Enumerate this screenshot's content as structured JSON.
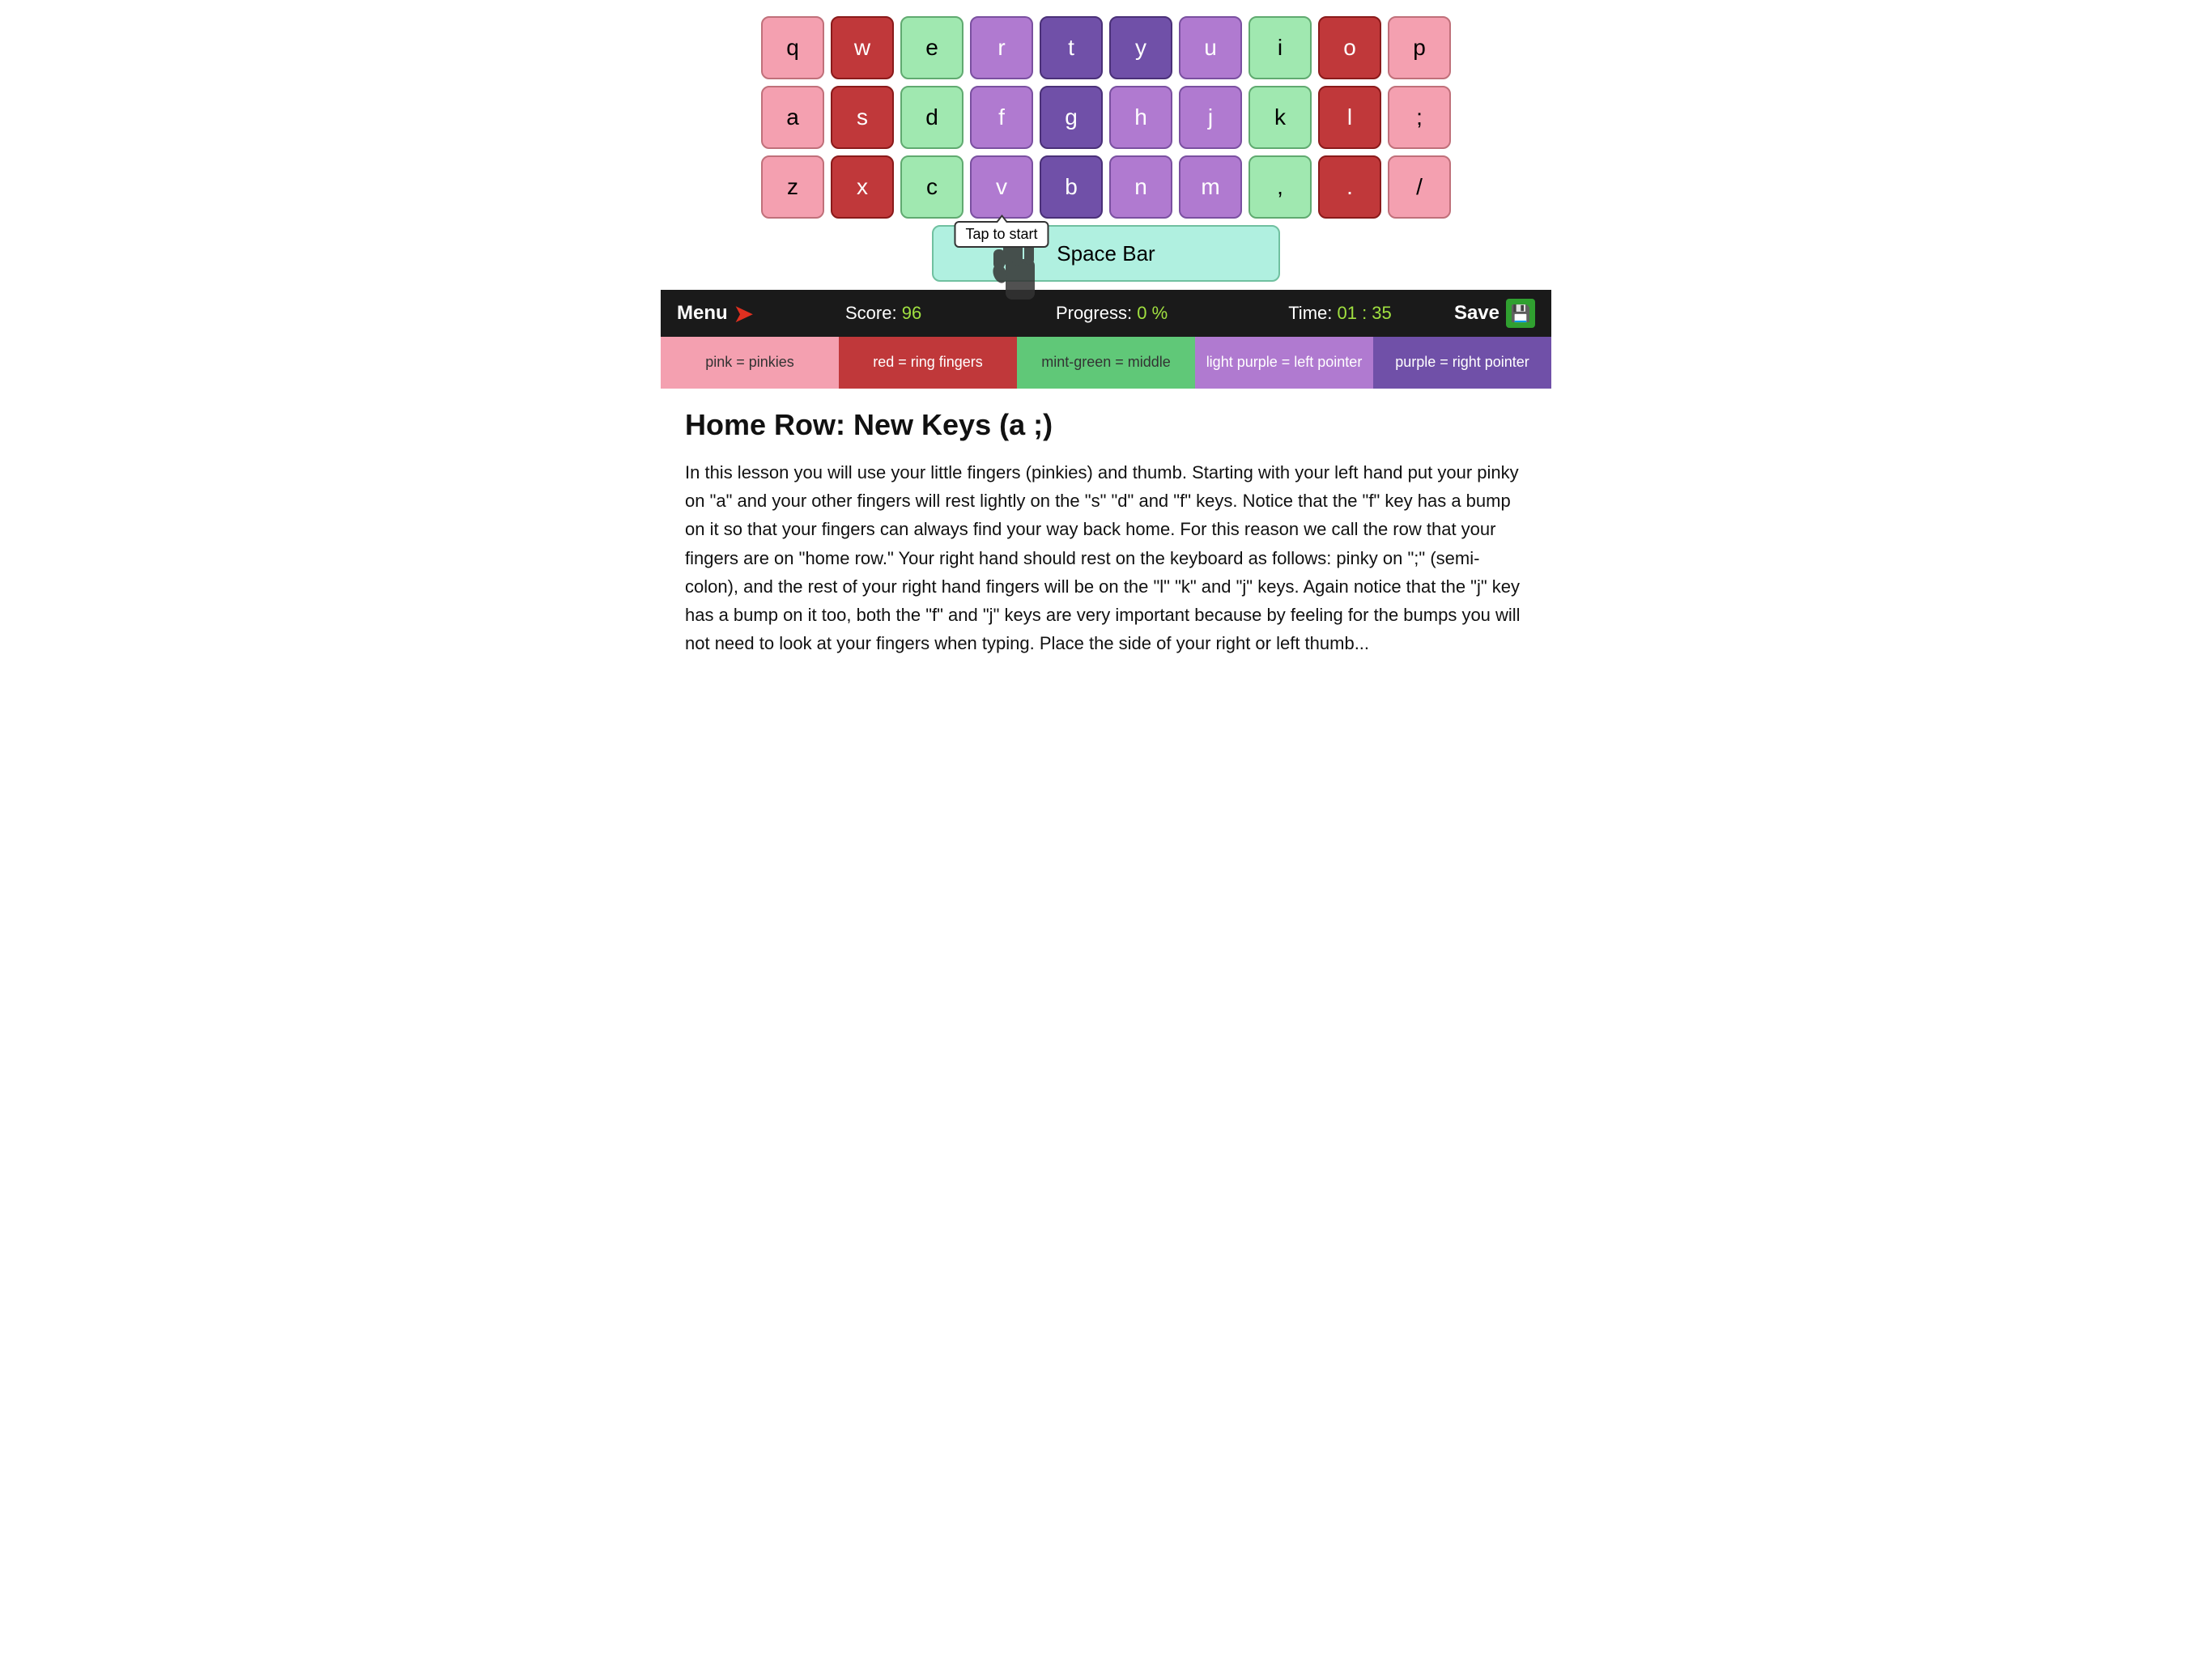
{
  "keyboard": {
    "row1": [
      {
        "key": "q",
        "color": "pink"
      },
      {
        "key": "w",
        "color": "red"
      },
      {
        "key": "e",
        "color": "green"
      },
      {
        "key": "r",
        "color": "purple-light"
      },
      {
        "key": "t",
        "color": "purple-dark"
      },
      {
        "key": "y",
        "color": "purple-dark"
      },
      {
        "key": "u",
        "color": "purple-light"
      },
      {
        "key": "i",
        "color": "green"
      },
      {
        "key": "o",
        "color": "red"
      },
      {
        "key": "p",
        "color": "pink"
      }
    ],
    "row2": [
      {
        "key": "a",
        "color": "pink"
      },
      {
        "key": "s",
        "color": "red"
      },
      {
        "key": "d",
        "color": "green"
      },
      {
        "key": "f",
        "color": "purple-light"
      },
      {
        "key": "g",
        "color": "purple-dark"
      },
      {
        "key": "h",
        "color": "purple-light"
      },
      {
        "key": "j",
        "color": "purple-light"
      },
      {
        "key": "k",
        "color": "green"
      },
      {
        "key": "l",
        "color": "red"
      },
      {
        "key": ";",
        "color": "pink"
      }
    ],
    "row3": [
      {
        "key": "z",
        "color": "pink"
      },
      {
        "key": "x",
        "color": "red"
      },
      {
        "key": "c",
        "color": "green"
      },
      {
        "key": "v",
        "color": "purple-light"
      },
      {
        "key": "b",
        "color": "purple-dark"
      },
      {
        "key": "n",
        "color": "purple-light"
      },
      {
        "key": "m",
        "color": "purple-light"
      },
      {
        "key": ",",
        "color": "green"
      },
      {
        "key": ".",
        "color": "red"
      },
      {
        "key": "/",
        "color": "pink"
      }
    ],
    "spacebar_label": "Space Bar",
    "tap_tooltip": "Tap to start"
  },
  "toolbar": {
    "menu_label": "Menu",
    "score_label": "Score:",
    "score_value": "96",
    "progress_label": "Progress:",
    "progress_value": "0 %",
    "time_label": "Time:",
    "time_value": "01 : 35",
    "save_label": "Save"
  },
  "legend": [
    {
      "label": "pink = pinkies",
      "color": "pink"
    },
    {
      "label": "red = ring fingers",
      "color": "red"
    },
    {
      "label": "mint-green = middle",
      "color": "green"
    },
    {
      "label": "light purple = left pointer",
      "color": "purple-light"
    },
    {
      "label": "purple = right pointer",
      "color": "purple-dark"
    }
  ],
  "content": {
    "title": "Home Row: New Keys (a ;)",
    "body": "In this lesson you will use your little fingers (pinkies) and thumb. Starting with your left hand put your pinky on \"a\" and your other fingers will rest lightly on the \"s\" \"d\" and \"f\" keys. Notice that the \"f\" key has a bump on it so that your fingers can always find your way back home. For this reason we call the row that your fingers are on \"home row.\" Your right hand should rest on the keyboard as follows: pinky on \";\" (semi-colon), and the rest of your right hand fingers will be on the \"l\" \"k\" and \"j\" keys. Again notice that the \"j\" key has a bump on it too, both the \"f\" and \"j\" keys are very important because by feeling for the bumps you will not need to look at your fingers when typing. Place the side of your right or left thumb..."
  }
}
